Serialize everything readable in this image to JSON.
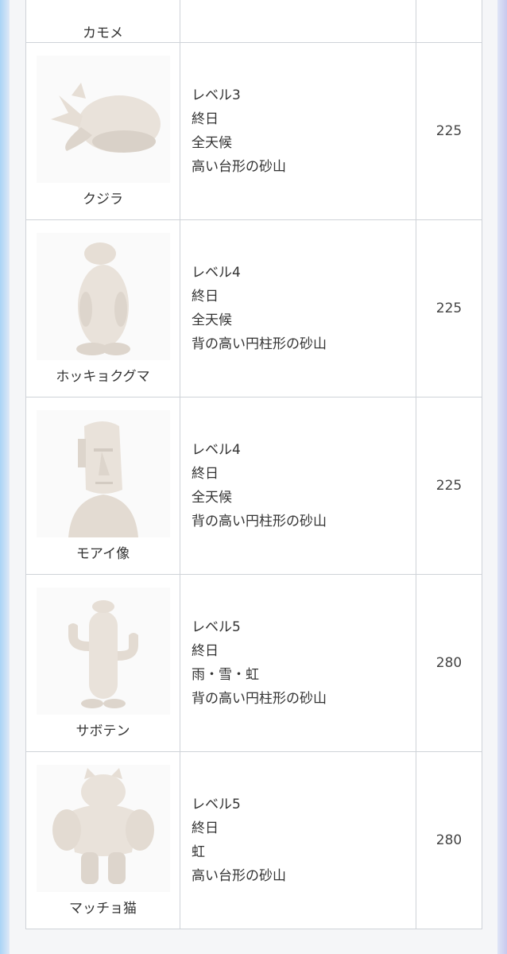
{
  "rows": [
    {
      "name": "カモメ",
      "lines": [],
      "points": "",
      "icon": "seagull-sand-sculpture"
    },
    {
      "name": "クジラ",
      "lines": [
        "レベル3",
        "終日",
        "全天候",
        "高い台形の砂山"
      ],
      "points": "225",
      "icon": "whale-sand-sculpture"
    },
    {
      "name": "ホッキョクグマ",
      "lines": [
        "レベル4",
        "終日",
        "全天候",
        "背の高い円柱形の砂山"
      ],
      "points": "225",
      "icon": "polar-bear-sand-sculpture"
    },
    {
      "name": "モアイ像",
      "lines": [
        "レベル4",
        "終日",
        "全天候",
        "背の高い円柱形の砂山"
      ],
      "points": "225",
      "icon": "moai-sand-sculpture"
    },
    {
      "name": "サボテン",
      "lines": [
        "レベル5",
        "終日",
        "雨・雪・虹",
        "背の高い円柱形の砂山"
      ],
      "points": "280",
      "icon": "cactus-sand-sculpture"
    },
    {
      "name": "マッチョ猫",
      "lines": [
        "レベル5",
        "終日",
        "虹",
        "高い台形の砂山"
      ],
      "points": "280",
      "icon": "macho-cat-sand-sculpture"
    }
  ],
  "colors": {
    "sand": "#e9e2da",
    "sand_shadow": "#d3cbc2",
    "border": "#cfd3d8"
  }
}
